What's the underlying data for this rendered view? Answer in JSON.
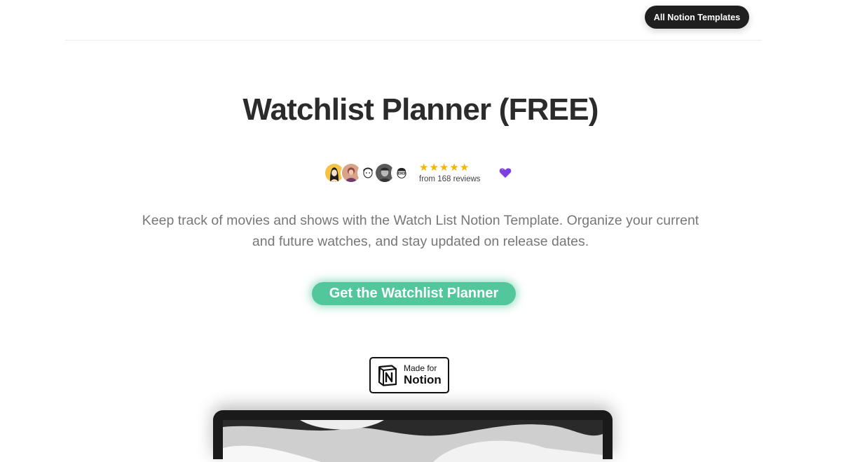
{
  "header": {
    "nav_button_label": "All Notion Templates"
  },
  "hero": {
    "title": "Watchlist Planner (FREE)",
    "rating": {
      "stars": 5,
      "reviews_text": "from 168 reviews"
    },
    "avatars": [
      "avatar-1",
      "avatar-2",
      "avatar-3",
      "avatar-4",
      "avatar-5"
    ],
    "description": "Keep track of movies and shows with the Watch List Notion Template. Organize your current and future watches, and stay updated on release dates.",
    "cta_label": "Get the Watchlist Planner"
  },
  "badge": {
    "small_text": "Made for",
    "big_text": "Notion",
    "icon": "notion-logo-icon"
  },
  "colors": {
    "cta": "#52c79c",
    "nav_button": "#1f1f1f",
    "star": "#f7b400",
    "heart": "#7b3fe4"
  }
}
